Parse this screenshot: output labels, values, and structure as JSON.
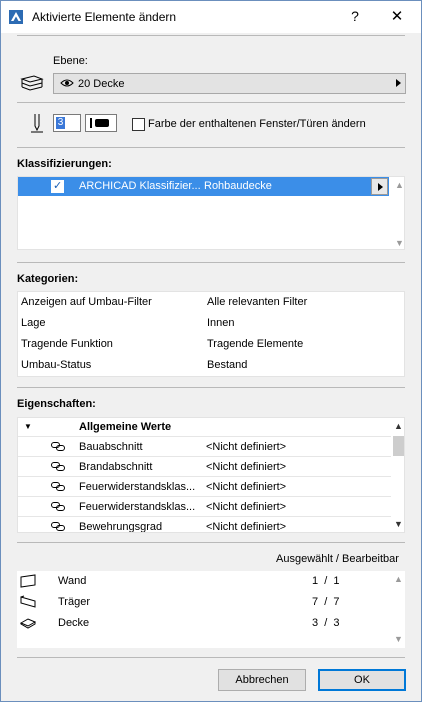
{
  "window": {
    "title": "Aktivierte Elemente ändern",
    "help_glyph": "?",
    "close_glyph": "✕"
  },
  "layer": {
    "label": "Ebene:",
    "value": "20 Decke",
    "icon": "layers-icon"
  },
  "pen": {
    "value": "3",
    "checkbox_label": "Farbe der enthaltenen Fenster/Türen ändern",
    "checkbox_checked": false
  },
  "classifications": {
    "header": "Klassifizierungen:",
    "rows": [
      {
        "checked": true,
        "system": "ARCHICAD Klassifizier...",
        "value": "Rohbaudecke"
      }
    ]
  },
  "categories": {
    "header": "Kategorien:",
    "rows": [
      {
        "name": "Anzeigen auf Umbau-Filter",
        "value": "Alle relevanten Filter"
      },
      {
        "name": "Lage",
        "value": "Innen"
      },
      {
        "name": "Tragende Funktion",
        "value": "Tragende Elemente"
      },
      {
        "name": "Umbau-Status",
        "value": "Bestand"
      }
    ]
  },
  "properties": {
    "header": "Eigenschaften:",
    "group": "Allgemeine Werte",
    "rows": [
      {
        "name": "Bauabschnitt",
        "value": "<Nicht definiert>"
      },
      {
        "name": "Brandabschnitt",
        "value": "<Nicht definiert>"
      },
      {
        "name": "Feuerwiderstandsklas...",
        "value": "<Nicht definiert>"
      },
      {
        "name": "Feuerwiderstandsklas...",
        "value": "<Nicht definiert>"
      },
      {
        "name": "Bewehrungsgrad",
        "value": "<Nicht definiert>"
      }
    ]
  },
  "selection": {
    "header": "Ausgewählt / Bearbeitbar",
    "rows": [
      {
        "icon": "wall-icon",
        "name": "Wand",
        "count": "1  /  1"
      },
      {
        "icon": "beam-icon",
        "name": "Träger",
        "count": "7  /  7"
      },
      {
        "icon": "slab-icon",
        "name": "Decke",
        "count": "3  /  3"
      }
    ]
  },
  "buttons": {
    "cancel": "Abbrechen",
    "ok": "OK"
  }
}
